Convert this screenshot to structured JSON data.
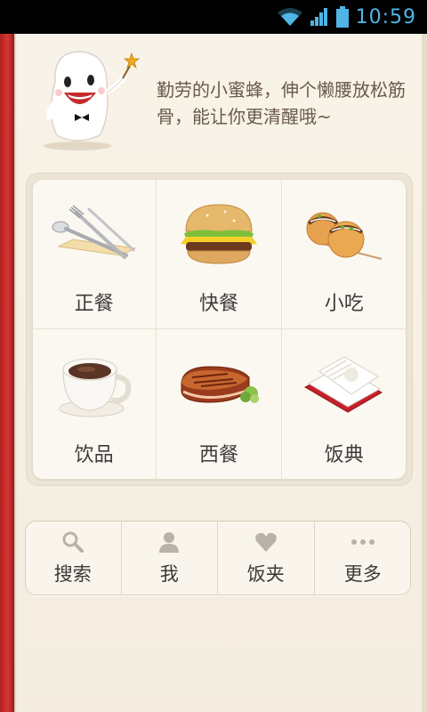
{
  "status_bar": {
    "time": "10:59"
  },
  "header": {
    "slogan": "勤劳的小蜜蜂，伸个懒腰放松筋骨，能让你更清醒哦~"
  },
  "categories": [
    {
      "label": "正餐",
      "icon": "cutlery-icon"
    },
    {
      "label": "快餐",
      "icon": "hamburger-icon"
    },
    {
      "label": "小吃",
      "icon": "takoyaki-icon"
    },
    {
      "label": "饮品",
      "icon": "coffee-cup-icon"
    },
    {
      "label": "西餐",
      "icon": "steak-icon"
    },
    {
      "label": "饭典",
      "icon": "recipe-book-icon"
    }
  ],
  "nav": [
    {
      "label": "搜索",
      "icon": "search-icon"
    },
    {
      "label": "我",
      "icon": "user-icon"
    },
    {
      "label": "饭夹",
      "icon": "heart-icon"
    },
    {
      "label": "更多",
      "icon": "more-dots-icon"
    }
  ],
  "colors": {
    "binding": "#c0211e",
    "status_accent": "#4fb5e6",
    "background": "#f6f0e4"
  }
}
